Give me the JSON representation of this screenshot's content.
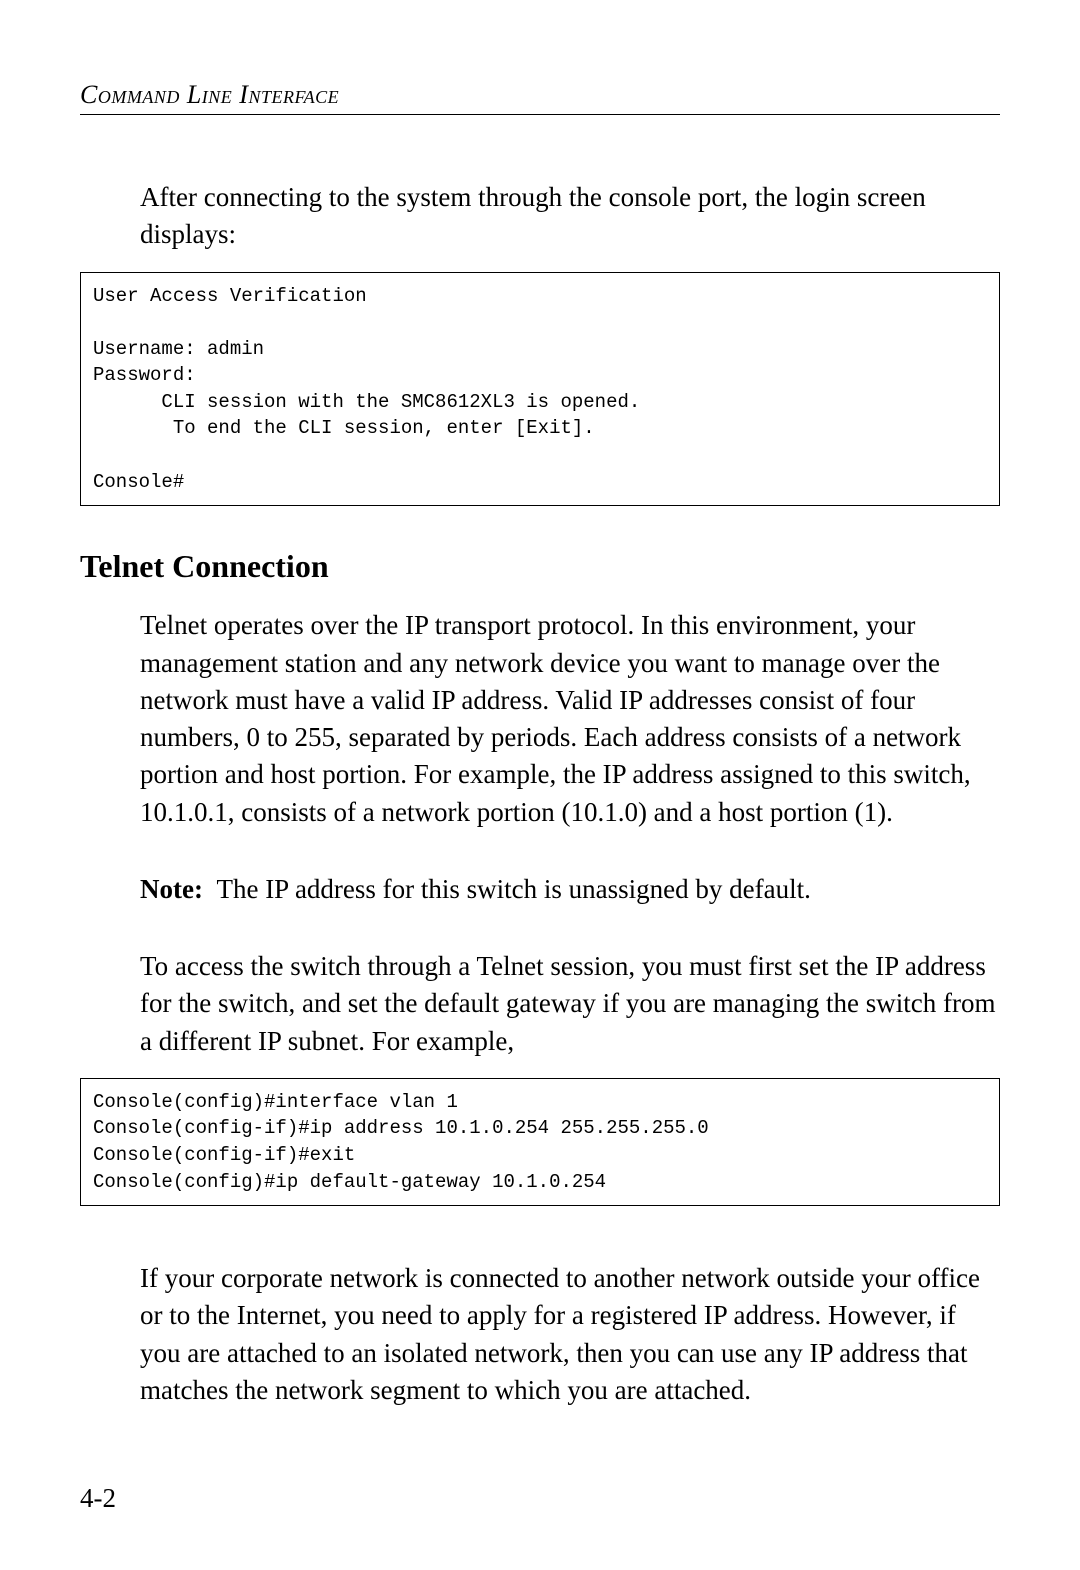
{
  "header": {
    "running_title": "Command Line Interface"
  },
  "intro": {
    "p1": "After connecting to the system through the console port, the login screen displays:"
  },
  "code": {
    "login": "User Access Verification\n\nUsername: admin\nPassword:\n      CLI session with the SMC8612XL3 is opened.\n       To end the CLI session, enter [Exit].\n\nConsole#",
    "telnet_setup": "Console(config)#interface vlan 1\nConsole(config-if)#ip address 10.1.0.254 255.255.255.0\nConsole(config-if)#exit\nConsole(config)#ip default-gateway 10.1.0.254"
  },
  "telnet": {
    "heading": "Telnet Connection",
    "p1": "Telnet operates over the IP transport protocol. In this environment, your management station and any network device you want to manage over the network must have a valid IP address. Valid IP addresses consist of four numbers, 0 to 255, separated by periods. Each address consists of a network portion and host portion. For example, the IP address assigned to this switch, 10.1.0.1, consists of a network portion (10.1.0) and a host portion (1).",
    "note_label": "Note:",
    "note_text": "The IP address for this switch is unassigned by default.",
    "p2": "To access the switch through a Telnet session, you must first set the IP address for the switch, and set the default gateway if you are managing the switch from a different IP subnet. For example,",
    "p3": "If your corporate network is connected to another network outside your office or to the Internet, you need to apply for a registered IP address. However, if you are attached to an isolated network, then you can use any IP address that matches the network segment to which you are attached."
  },
  "page_number": "4-2"
}
